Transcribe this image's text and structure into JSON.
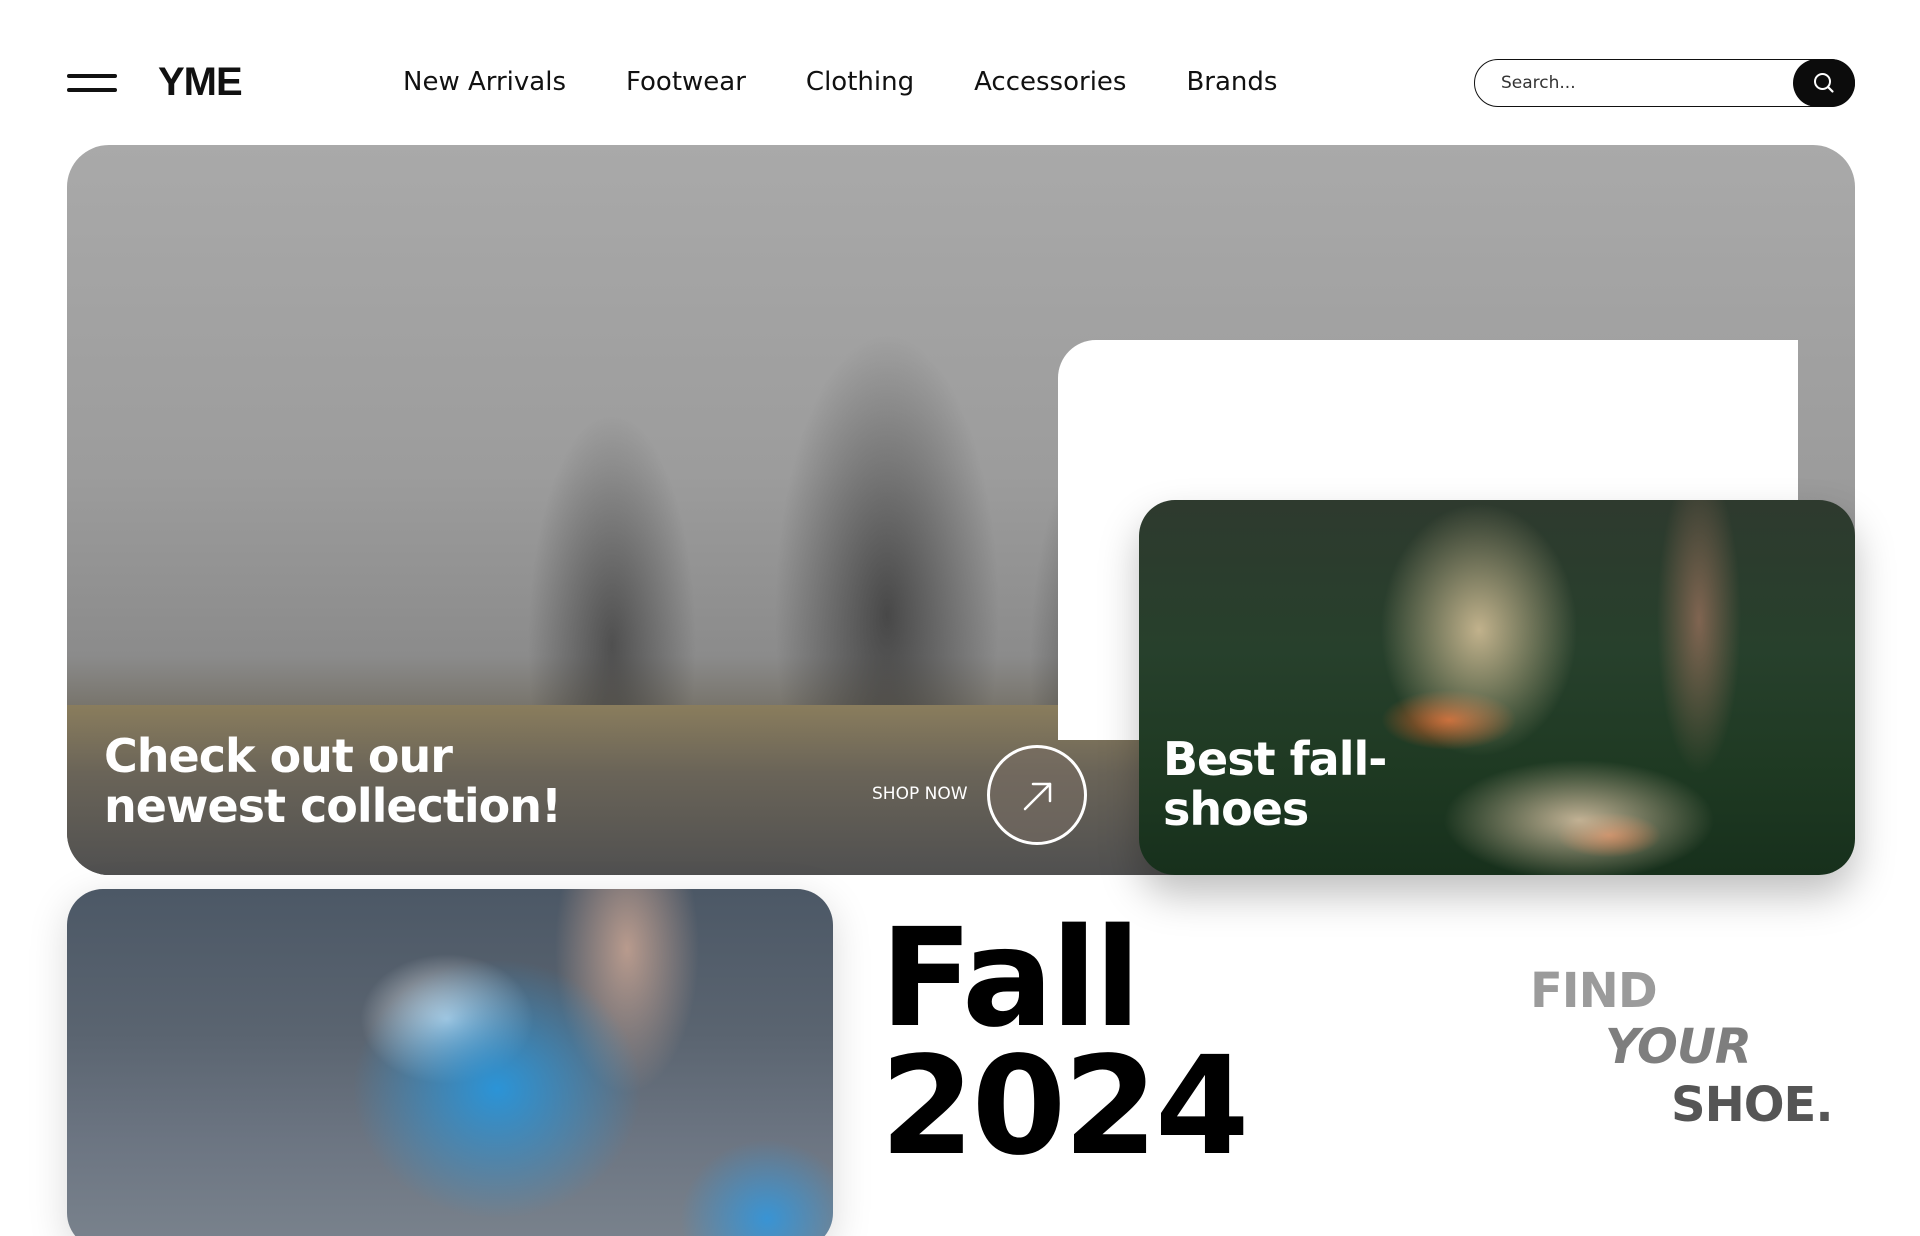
{
  "header": {
    "logo": "YME",
    "nav": [
      "New Arrivals",
      "Footwear",
      "Clothing",
      "Accessories",
      "Brands"
    ],
    "search_placeholder": "Search..."
  },
  "hero": {
    "title_line1": "Check out our",
    "title_line2": "newest collection!",
    "cta_label": "SHOP NOW"
  },
  "shoes_card": {
    "title_line1": "Best fall-",
    "title_line2": "shoes"
  },
  "season": {
    "line1": "Fall",
    "line2": "2024"
  },
  "tagline": {
    "line1": "FIND",
    "line2": "YOUR",
    "line3": "SHOE."
  },
  "icons": {
    "menu": "hamburger-menu-icon",
    "search": "search-icon",
    "arrow": "arrow-up-right-icon"
  },
  "colors": {
    "text": "#111111",
    "background": "#ffffff",
    "search_button": "#0c0c0c"
  }
}
